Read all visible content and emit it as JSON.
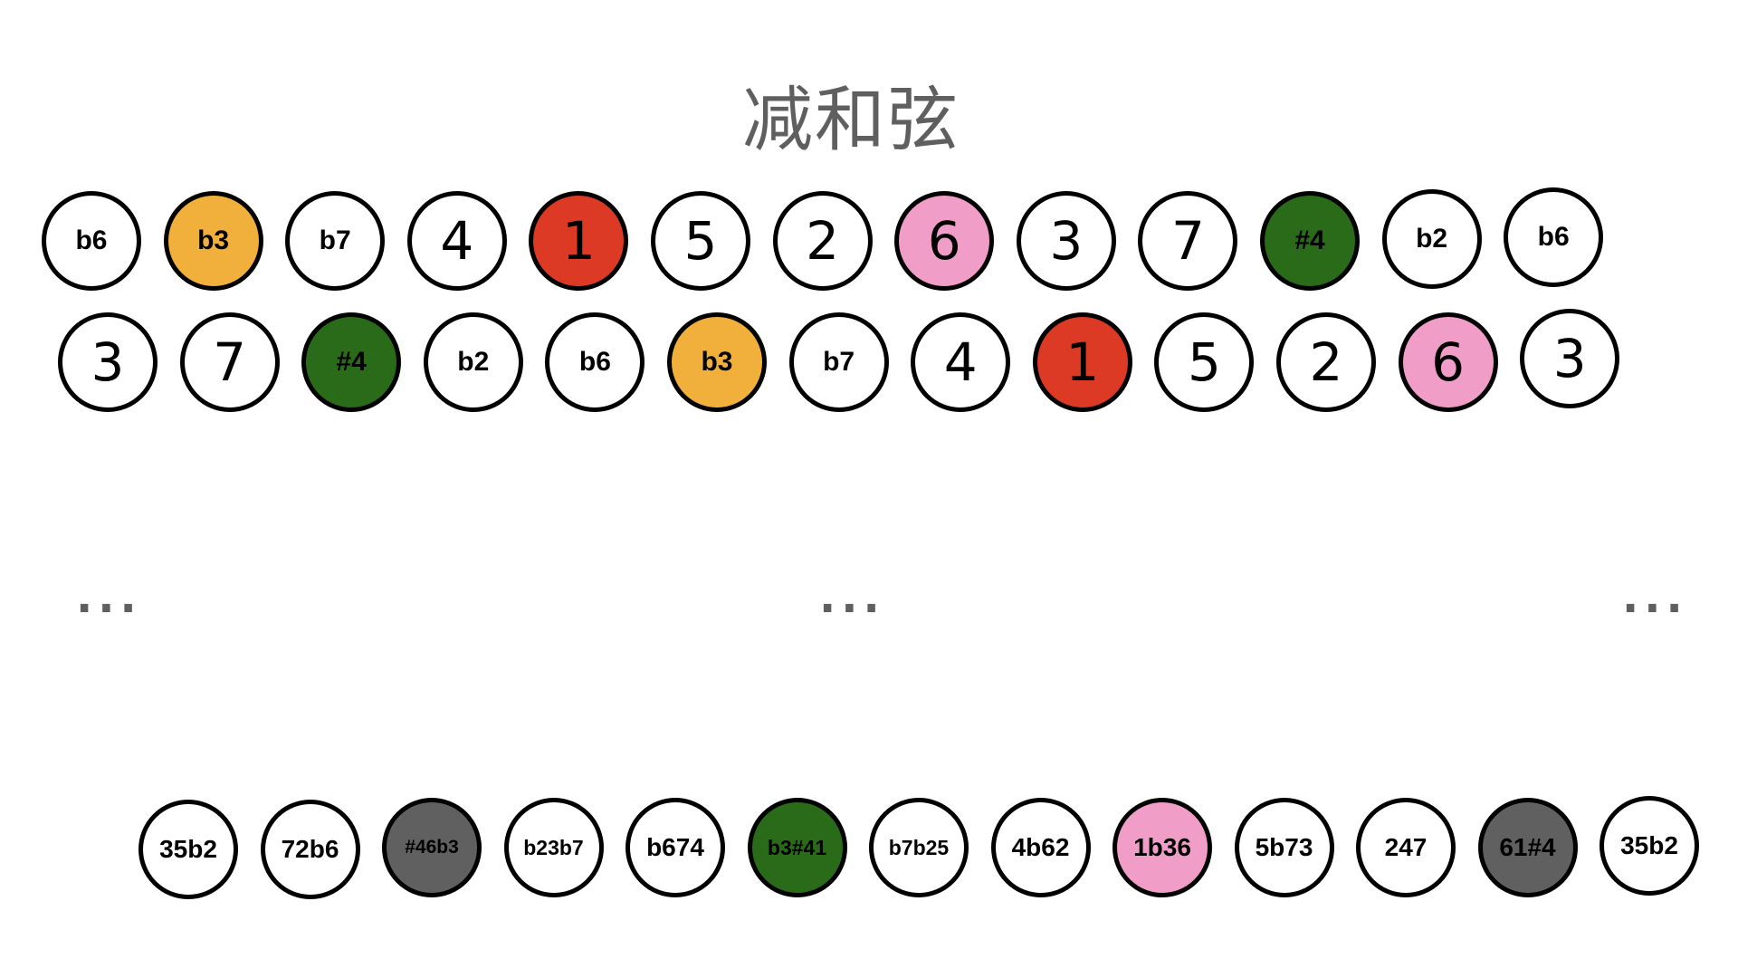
{
  "title": "减和弦",
  "colors": {
    "white": "#ffffff",
    "yellow": "#f1b03b",
    "red": "#dc3a25",
    "pink": "#f09ec8",
    "green": "#2a6b1a",
    "gray": "#606060",
    "title_gray": "#5f5f5f"
  },
  "row1": [
    {
      "label": "b6",
      "fill": "white"
    },
    {
      "label": "b3",
      "fill": "yellow"
    },
    {
      "label": "b7",
      "fill": "white"
    },
    {
      "label": "4",
      "fill": "white"
    },
    {
      "label": "1",
      "fill": "red"
    },
    {
      "label": "5",
      "fill": "white"
    },
    {
      "label": "2",
      "fill": "white"
    },
    {
      "label": "6",
      "fill": "pink"
    },
    {
      "label": "3",
      "fill": "white"
    },
    {
      "label": "7",
      "fill": "white"
    },
    {
      "label": "#4",
      "fill": "green"
    },
    {
      "label": "b2",
      "fill": "white"
    },
    {
      "label": "b6",
      "fill": "white"
    }
  ],
  "row2": [
    {
      "label": "3",
      "fill": "white"
    },
    {
      "label": "7",
      "fill": "white"
    },
    {
      "label": "#4",
      "fill": "green"
    },
    {
      "label": "b2",
      "fill": "white"
    },
    {
      "label": "b6",
      "fill": "white"
    },
    {
      "label": "b3",
      "fill": "yellow"
    },
    {
      "label": "b7",
      "fill": "white"
    },
    {
      "label": "4",
      "fill": "white"
    },
    {
      "label": "1",
      "fill": "red"
    },
    {
      "label": "5",
      "fill": "white"
    },
    {
      "label": "2",
      "fill": "white"
    },
    {
      "label": "6",
      "fill": "pink"
    },
    {
      "label": "3",
      "fill": "white"
    }
  ],
  "ellipses": [
    "...",
    "...",
    "..."
  ],
  "chords": [
    {
      "label": "35b2",
      "fill": "white"
    },
    {
      "label": "72b6",
      "fill": "white"
    },
    {
      "label": "#46b3",
      "fill": "gray"
    },
    {
      "label": "b23b7",
      "fill": "white"
    },
    {
      "label": "b674",
      "fill": "white"
    },
    {
      "label": "b3#41",
      "fill": "green"
    },
    {
      "label": "b7b25",
      "fill": "white"
    },
    {
      "label": "4b62",
      "fill": "white"
    },
    {
      "label": "1b36",
      "fill": "pink"
    },
    {
      "label": "5b73",
      "fill": "white"
    },
    {
      "label": "247",
      "fill": "white"
    },
    {
      "label": "61#4",
      "fill": "gray"
    },
    {
      "label": "35b2",
      "fill": "white"
    }
  ]
}
